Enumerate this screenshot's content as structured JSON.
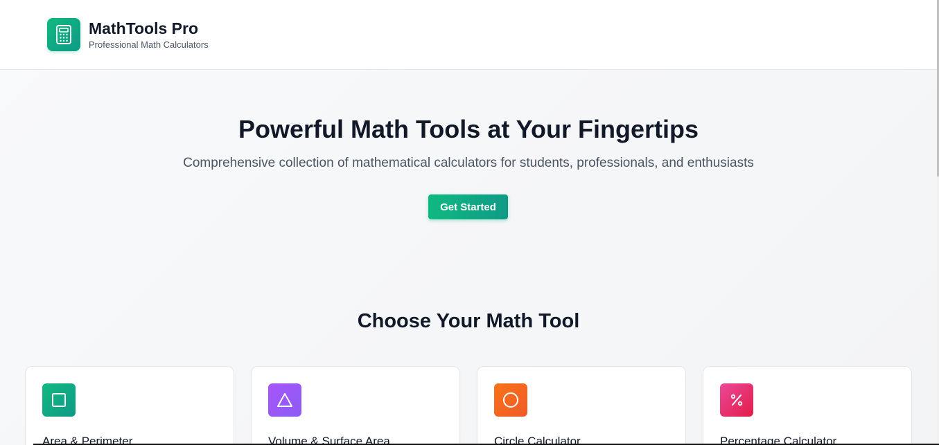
{
  "header": {
    "brand_title": "MathTools Pro",
    "brand_subtitle": "Professional Math Calculators",
    "logo_icon": "calculator-icon"
  },
  "hero": {
    "title": "Powerful Math Tools at Your Fingertips",
    "subtitle": "Comprehensive collection of mathematical calculators for students, professionals, and enthusiasts",
    "cta_label": "Get Started"
  },
  "tools": {
    "section_title": "Choose Your Math Tool",
    "cards": [
      {
        "label": "Area & Perimeter",
        "icon": "square-icon",
        "color_from": "#10b981",
        "color_to": "#0f9a86"
      },
      {
        "label": "Volume & Surface Area",
        "icon": "triangle-icon",
        "color_from": "#a855f7",
        "color_to": "#8b5cf6"
      },
      {
        "label": "Circle Calculator",
        "icon": "circle-icon",
        "color_from": "#f97316",
        "color_to": "#ef5a2a"
      },
      {
        "label": "Percentage Calculator",
        "icon": "percent-icon",
        "color_from": "#ec4899",
        "color_to": "#e11d48"
      }
    ]
  },
  "colors": {
    "accent": "#10b981",
    "text_primary": "#111827",
    "text_secondary": "#4b5563"
  }
}
